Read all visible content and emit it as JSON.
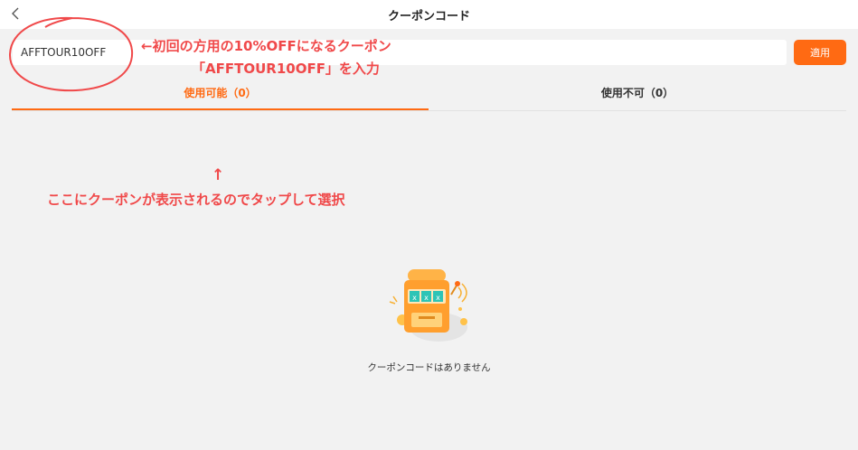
{
  "header": {
    "title": "クーポンコード",
    "back_icon": "chevron-left-icon"
  },
  "coupon_form": {
    "input_value": "AFFTOUR10OFF",
    "apply_label": "適用"
  },
  "annotations": {
    "line1": "←初回の方用の10%OFFになるクーポン",
    "line2": "「AFFTOUR10OFF」を入力",
    "arrow": "↑",
    "line3": "ここにクーポンが表示されるのでタップして選択",
    "color": "#f0494a"
  },
  "tabs": [
    {
      "label": "使用可能（0）",
      "active": true
    },
    {
      "label": "使用不可（0）",
      "active": false
    }
  ],
  "empty_state": {
    "icon": "slot-machine-illustration",
    "message": "クーポンコードはありません"
  },
  "colors": {
    "accent": "#ff6a13",
    "background": "#f2f2f2",
    "annotation": "#f0494a"
  }
}
